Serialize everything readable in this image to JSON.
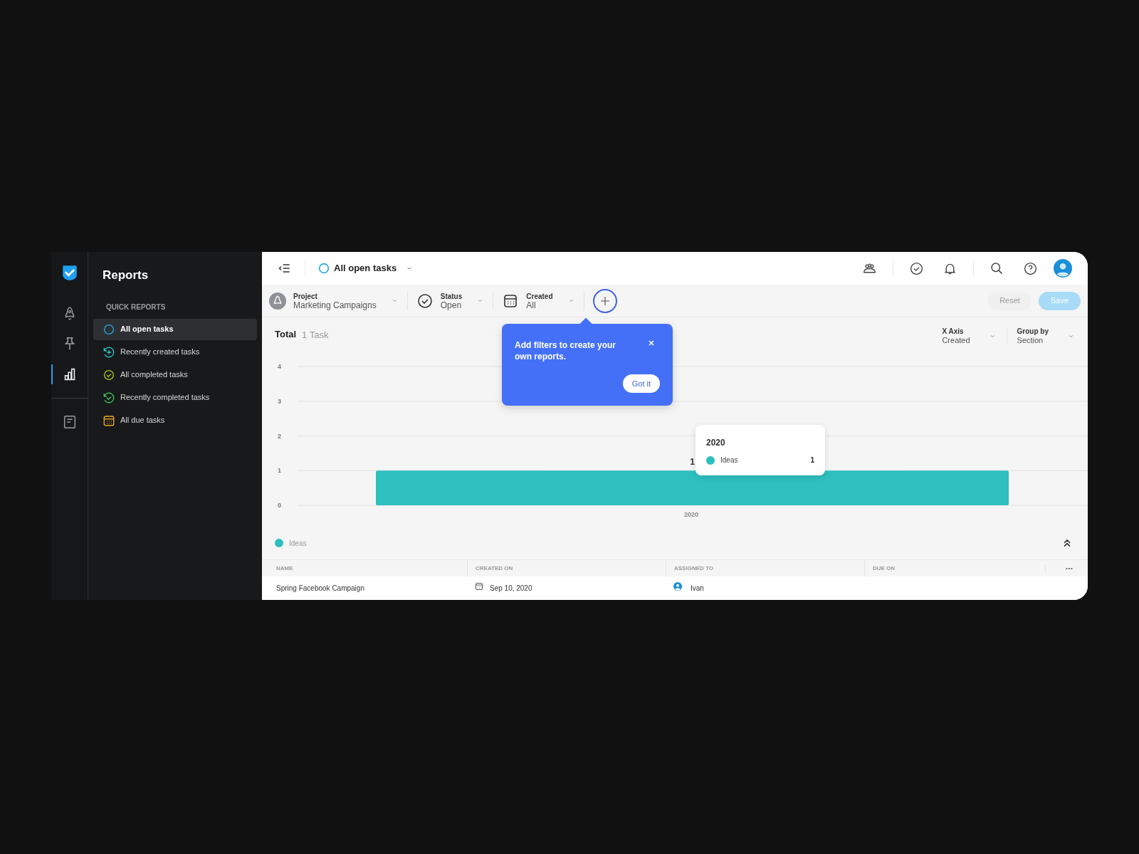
{
  "rail": [
    {
      "kind": "rocket",
      "selected": false
    },
    {
      "kind": "pin",
      "selected": false
    },
    {
      "kind": "chart",
      "selected": true
    },
    {
      "kind": "page",
      "selected": false
    }
  ],
  "sidebar": {
    "title": "Reports",
    "section": "QUICK REPORTS",
    "items": [
      {
        "kind": "open",
        "label": "All open tasks",
        "selected": true
      },
      {
        "kind": "created",
        "label": "Recently created tasks",
        "selected": false
      },
      {
        "kind": "completed",
        "label": "All completed tasks",
        "selected": false
      },
      {
        "kind": "recent_completed",
        "label": "Recently completed tasks",
        "selected": false
      },
      {
        "kind": "due",
        "label": "All due tasks",
        "selected": false
      }
    ]
  },
  "topbar": {
    "title": "All open tasks"
  },
  "filters": [
    {
      "kind": "project",
      "label": "Project",
      "value": "Marketing Campaigns"
    },
    {
      "kind": "status",
      "label": "Status",
      "value": "Open"
    },
    {
      "kind": "date",
      "label": "Created",
      "value": "All"
    }
  ],
  "actions": [
    {
      "kind": "reset",
      "label": "Reset",
      "disabled": true
    },
    {
      "kind": "save",
      "label": "Save",
      "disabled": true
    }
  ],
  "summary": {
    "label": "Total",
    "count": "1 Task"
  },
  "axis_controls": [
    {
      "label": "X Axis",
      "value": "Created"
    },
    {
      "label": "Group by",
      "value": "Section"
    }
  ],
  "chart_data": {
    "type": "bar",
    "categories": [
      "2020"
    ],
    "series": [
      {
        "name": "Ideas",
        "color": "#2fbfbf",
        "values": [
          1
        ]
      }
    ],
    "ylim": [
      0,
      4
    ],
    "yticks": [
      0,
      1,
      2,
      3,
      4
    ],
    "grid": true,
    "data_labels": true
  },
  "tooltip": {
    "title": "2020",
    "items": [
      {
        "label": "Ideas",
        "value": "1",
        "color": "#2fbfbf"
      }
    ]
  },
  "popover": {
    "text": "Add filters to create your own reports.",
    "button": "Got it"
  },
  "table": {
    "columns": [
      "NAME",
      "CREATED ON",
      "ASSIGNED TO",
      "DUE ON"
    ],
    "rows": [
      {
        "name": "Spring Facebook Campaign",
        "created_on": "Sep 10, 2020",
        "assigned_to": "Ivan"
      }
    ]
  }
}
